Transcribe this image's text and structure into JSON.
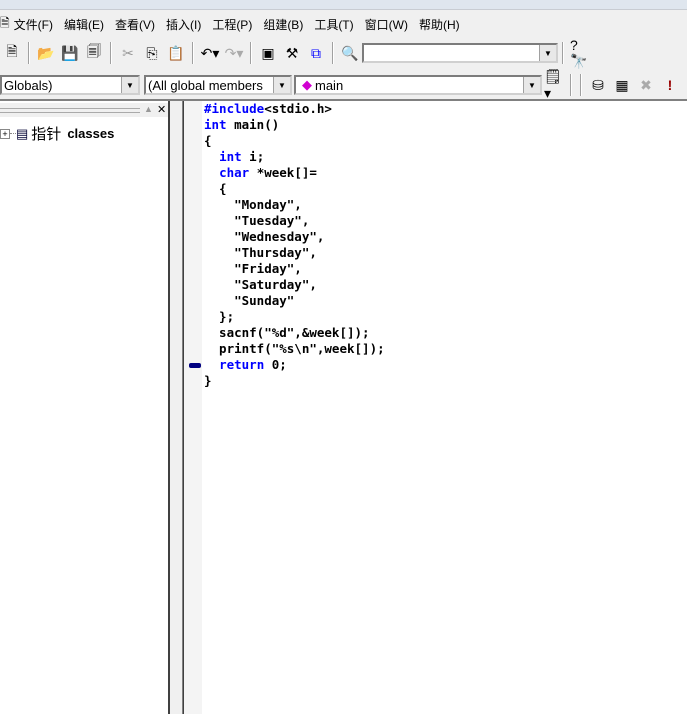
{
  "menu": [
    "文件(F)",
    "编辑(E)",
    "查看(V)",
    "插入(I)",
    "工程(P)",
    "组建(B)",
    "工具(T)",
    "窗口(W)",
    "帮助(H)"
  ],
  "toolbar2": {
    "scope": "Globals)",
    "members": "(All global members",
    "function": "main"
  },
  "left_pane": {
    "tree_root": "指针",
    "tree_root_suffix": "classes"
  },
  "code": [
    [
      [
        "kw",
        "#include"
      ],
      [
        "",
        "<stdio.h>"
      ]
    ],
    [
      [
        "kw",
        "int"
      ],
      [
        "",
        " main()"
      ]
    ],
    [
      [
        "",
        "{"
      ]
    ],
    [
      [
        "",
        "  "
      ],
      [
        "kw",
        "int"
      ],
      [
        "",
        " i;"
      ]
    ],
    [
      [
        "",
        "  "
      ],
      [
        "kw",
        "char"
      ],
      [
        "",
        " *week[]="
      ]
    ],
    [
      [
        "",
        "  {"
      ]
    ],
    [
      [
        "",
        "    \"Monday\","
      ]
    ],
    [
      [
        "",
        "    \"Tuesday\","
      ]
    ],
    [
      [
        "",
        "    \"Wednesday\","
      ]
    ],
    [
      [
        "",
        "    \"Thursday\","
      ]
    ],
    [
      [
        "",
        "    \"Friday\","
      ]
    ],
    [
      [
        "",
        "    \"Saturday\","
      ]
    ],
    [
      [
        "",
        "    \"Sunday\""
      ]
    ],
    [
      [
        "",
        "  };"
      ]
    ],
    [
      [
        "",
        "  sacnf(\"%d\",&week[]);"
      ]
    ],
    [
      [
        "",
        "  printf(\"%s\\n\",week[]);"
      ]
    ],
    [
      [
        "",
        "  "
      ],
      [
        "kw",
        "return"
      ],
      [
        "",
        " 0;"
      ]
    ],
    [
      [
        "",
        "}"
      ]
    ]
  ],
  "current_line_marker_line": 16,
  "colors": {
    "keyword": "#0000ff",
    "marker": "#000080"
  }
}
